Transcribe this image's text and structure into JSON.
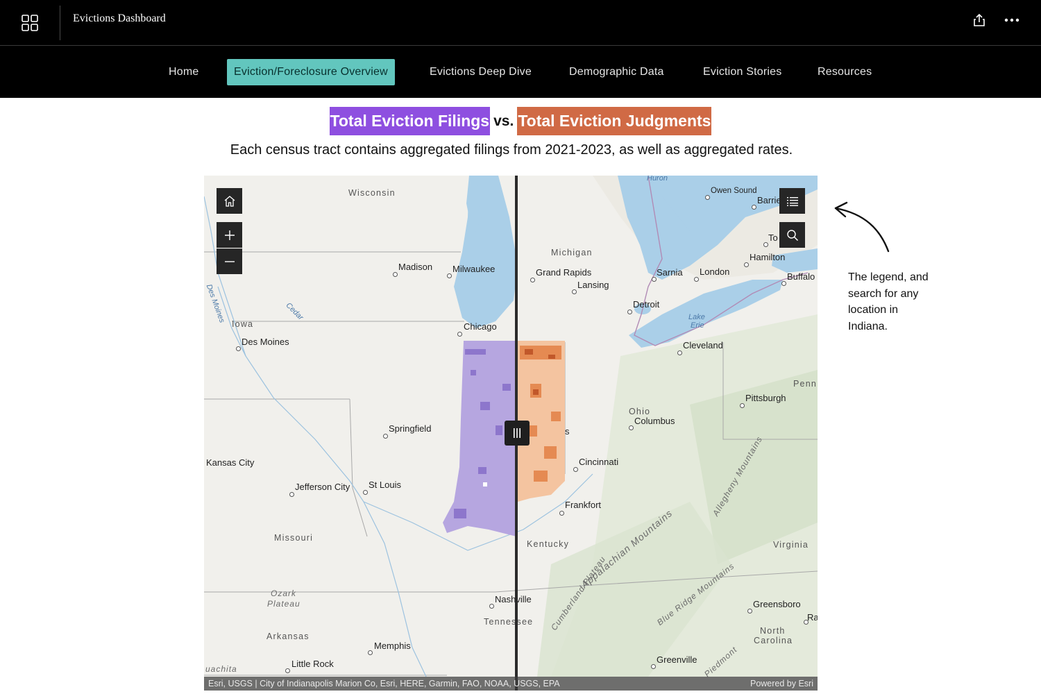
{
  "app": {
    "title": "Evictions Dashboard"
  },
  "nav": {
    "items": [
      {
        "label": "Home"
      },
      {
        "label": "Eviction/Foreclosure Overview"
      },
      {
        "label": "Evictions Deep Dive"
      },
      {
        "label": "Demographic Data"
      },
      {
        "label": "Eviction Stories"
      },
      {
        "label": "Resources"
      }
    ],
    "active_index": 1
  },
  "header": {
    "title_left": "Total Eviction Filings",
    "title_vs": "vs.",
    "title_right": "Total Eviction Judgments",
    "subtitle": "Each census tract contains aggregated filings from 2021-2023, as well as aggregated rates."
  },
  "colors": {
    "filings": "#8e4fe0",
    "judgments": "#d06a45",
    "active_tab": "#62c6be"
  },
  "icons": {
    "apps": "grid-icon",
    "share": "share-icon",
    "more": "more-icon",
    "home": "home-icon",
    "zoom_in": "plus-icon",
    "zoom_out": "minus-icon",
    "legend": "legend-list-icon",
    "search": "search-icon",
    "swipe": "swipe-handle-icon"
  },
  "map": {
    "places": {
      "wisconsin": "Wisconsin",
      "michigan": "Michigan",
      "iowa": "Iowa",
      "ohio": "Ohio",
      "penn": "Penn",
      "kentucky": "Kentucky",
      "missouri": "Missouri",
      "virginia": "Virginia",
      "arkansas": "Arkansas",
      "tennessee": "Tennessee",
      "north": "North",
      "carolina": "Carolina",
      "madison": "Madison",
      "milwaukee": "Milwaukee",
      "chicago": "Chicago",
      "grand_rapids": "Grand Rapids",
      "lansing": "Lansing",
      "detroit": "Detroit",
      "sarnia": "Sarnia",
      "london": "London",
      "hamilton": "Hamilton",
      "buffalo": "Buffalo",
      "barrie": "Barrie",
      "owen_sound": "Owen Sound",
      "toronto": "To",
      "cleveland": "Cleveland",
      "pittsburgh": "Pittsburgh",
      "columbus": "Columbus",
      "cincinnati": "Cincinnati",
      "frankfort": "Frankfort",
      "des_moines": "Des Moines",
      "kansas_city": "Kansas City",
      "jefferson_city": "Jefferson City",
      "st_louis": "St Louis",
      "springfield": "Springfield",
      "nashville": "Nashville",
      "memphis": "Memphis",
      "little_rock": "Little Rock",
      "greensboro": "Greensboro",
      "raleigh": "Raleig",
      "greenville": "Greenville",
      "indy_fragment": "s",
      "ouachita": "uachita"
    },
    "terrain": {
      "ozark": "Ozark",
      "plateau": "Plateau",
      "appalachian": "Appalachian Mountains",
      "cumberland": "Cumberland Plateau",
      "blue_ridge": "Blue Ridge Mountains",
      "allegheny": "Allegheny Mountains",
      "piedmont": "Piedmont"
    },
    "water": {
      "huron": "Huron",
      "lake_erie_1": "Lake",
      "lake_erie_2": "Erie",
      "des_moines_river": "Des Moines",
      "cedar": "Cedar"
    },
    "attribution": "Esri, USGS | City of Indianapolis Marion Co, Esri, HERE, Garmin, FAO, NOAA, USGS, EPA",
    "powered_by": "Powered by Esri"
  },
  "annotation": {
    "text": "The legend, and search for any location in Indiana."
  }
}
